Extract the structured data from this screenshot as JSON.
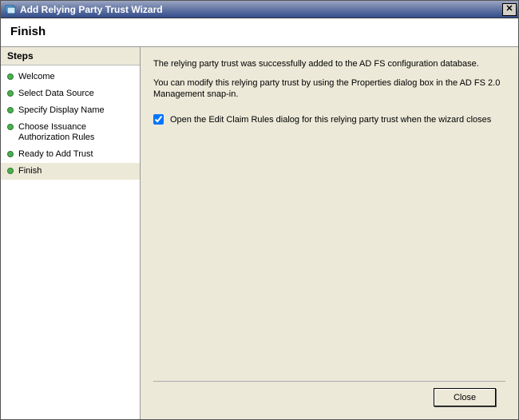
{
  "window": {
    "title": "Add Relying Party Trust Wizard"
  },
  "header": {
    "title": "Finish"
  },
  "sidebar": {
    "steps_header": "Steps",
    "items": [
      {
        "label": "Welcome"
      },
      {
        "label": "Select Data Source"
      },
      {
        "label": "Specify Display Name"
      },
      {
        "label": "Choose Issuance Authorization Rules"
      },
      {
        "label": "Ready to Add Trust"
      },
      {
        "label": "Finish"
      }
    ],
    "active_index": 5
  },
  "content": {
    "paragraph1": "The relying party trust was successfully added to the AD FS configuration database.",
    "paragraph2": "You can modify this relying party trust by using the Properties dialog box in the AD FS 2.0 Management snap-in.",
    "checkbox_label": "Open the Edit Claim Rules dialog for this relying party trust when the wizard closes",
    "checkbox_checked": true
  },
  "footer": {
    "close_label": "Close"
  }
}
